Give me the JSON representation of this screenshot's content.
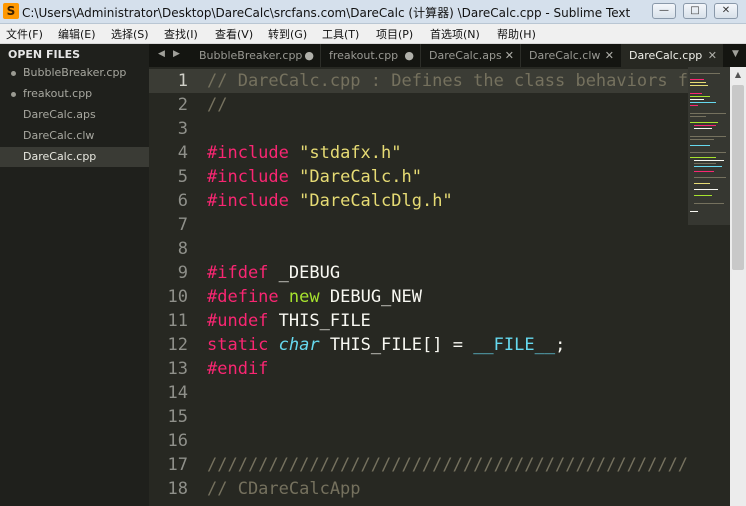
{
  "window": {
    "title": "C:\\Users\\Administrator\\Desktop\\DareCalc\\srcfans.com\\DareCalc (计算器) \\DareCalc.cpp - Sublime Text",
    "controls": {
      "minimize": "—",
      "maximize": "□",
      "close": "✕"
    }
  },
  "menu": [
    {
      "label": "文件(F)"
    },
    {
      "label": "编辑(E)"
    },
    {
      "label": "选择(S)"
    },
    {
      "label": "查找(I)"
    },
    {
      "label": "查看(V)"
    },
    {
      "label": "转到(G)"
    },
    {
      "label": "工具(T)"
    },
    {
      "label": "项目(P)"
    },
    {
      "label": "首选项(N)"
    },
    {
      "label": "帮助(H)"
    }
  ],
  "sidebar": {
    "header": "OPEN FILES",
    "items": [
      {
        "label": "BubbleBreaker.cpp"
      },
      {
        "label": "freakout.cpp"
      },
      {
        "label": "DareCalc.aps"
      },
      {
        "label": "DareCalc.clw"
      },
      {
        "label": "DareCalc.cpp"
      }
    ]
  },
  "tabs": {
    "nav_left": "◀",
    "nav_right": "▶",
    "dropdown": "▼",
    "items": [
      {
        "label": "BubbleBreaker.cpp",
        "mark": "●"
      },
      {
        "label": "freakout.cpp",
        "mark": "●"
      },
      {
        "label": "DareCalc.aps",
        "mark": "✕"
      },
      {
        "label": "DareCalc.clw",
        "mark": "✕"
      },
      {
        "label": "DareCalc.cpp",
        "mark": "✕"
      }
    ]
  },
  "editor": {
    "line_numbers": [
      "1",
      "2",
      "3",
      "4",
      "5",
      "6",
      "7",
      "8",
      "9",
      "10",
      "11",
      "12",
      "13",
      "14",
      "15",
      "16",
      "17",
      "18"
    ],
    "code": {
      "l1": "// DareCalc.cpp : Defines the class behaviors for the application.",
      "l2": "//",
      "l4_kw": "#include",
      "l4_str": "\"stdafx.h\"",
      "l5_kw": "#include",
      "l5_str": "\"DareCalc.h\"",
      "l6_kw": "#include",
      "l6_str": "\"DareCalcDlg.h\"",
      "l9_kw": "#ifdef",
      "l9_rest": "_DEBUG",
      "l10_kw": "#define",
      "l10_new": "new",
      "l10_rest": "DEBUG_NEW",
      "l11_kw": "#undef",
      "l11_rest": "THIS_FILE",
      "l12_kw": "static",
      "l12_type": "char",
      "l12_mid": "THIS_FILE[] =",
      "l12_const": "__FILE__",
      "l12_end": ";",
      "l13_kw": "#endif",
      "l17": "/////////////////////////////////////////////////////////////////////////////",
      "l18": "// CDareCalcApp"
    }
  },
  "scrollbar": {
    "up_arrow": "▲"
  },
  "colors": {
    "background": "#272822",
    "comment": "#75715e",
    "keyword": "#f92672",
    "string": "#e6db74",
    "function": "#a6e22e",
    "type": "#66d9ef"
  }
}
